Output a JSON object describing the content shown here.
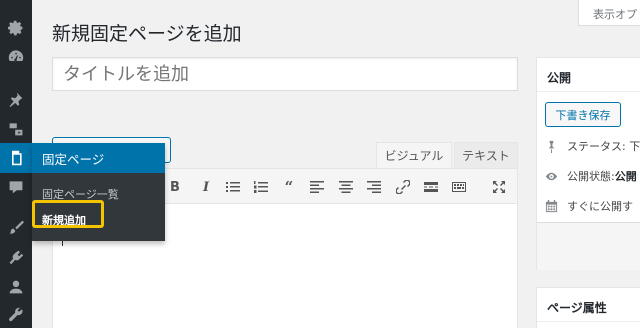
{
  "page": {
    "title": "新規固定ページを追加",
    "screen_options_label": "表示オプ"
  },
  "post_title": {
    "placeholder": "タイトルを追加"
  },
  "editor": {
    "tabs": {
      "visual": "ビジュアル",
      "text": "テキスト"
    }
  },
  "submenu": {
    "header": "固定ページ",
    "items": [
      "固定ページ一覧",
      "新規追加"
    ],
    "current_index": 1
  },
  "publish_box": {
    "title": "公開",
    "save_draft": "下書き保存",
    "status": "ステータス: 下",
    "visibility_label": "公開状態: ",
    "visibility_value": "公開",
    "schedule": "すぐに公開す"
  },
  "attributes_box": {
    "title": "ページ属性"
  },
  "colors": {
    "sidebar_bg": "#23282d",
    "active_blue": "#0073aa",
    "highlight": "#f5c400"
  }
}
